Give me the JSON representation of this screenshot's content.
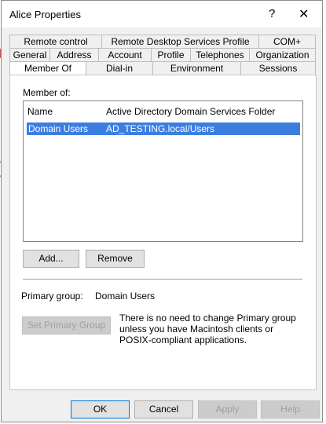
{
  "window": {
    "title": "Alice Properties",
    "help_glyph": "?",
    "close_glyph": "✕"
  },
  "tabs": {
    "row1": [
      "Remote control",
      "Remote Desktop Services Profile",
      "COM+"
    ],
    "row2": [
      "General",
      "Address",
      "Account",
      "Profile",
      "Telephones",
      "Organization"
    ],
    "row3": [
      "Member Of",
      "Dial-in",
      "Environment",
      "Sessions"
    ],
    "active": "Member Of"
  },
  "member_of": {
    "label": "Member of:",
    "columns": [
      "Name",
      "Active Directory Domain Services Folder"
    ],
    "rows": [
      {
        "name": "Domain Users",
        "folder": "AD_TESTING.local/Users",
        "selected": true
      }
    ],
    "add_label": "Add...",
    "remove_label": "Remove"
  },
  "primary_group": {
    "label": "Primary group:",
    "value": "Domain Users",
    "set_button_label": "Set Primary Group",
    "note": "There is no need to change Primary group unless you have Macintosh clients or POSIX-compliant applications."
  },
  "footer": {
    "ok": "OK",
    "cancel": "Cancel",
    "apply": "Apply",
    "help": "Help"
  },
  "colors": {
    "selection": "#3c7ee0",
    "dialog_bg": "#f0f0f0",
    "default_button_border": "#0078d7"
  },
  "icons": {
    "help": "question-mark-icon",
    "close": "close-icon"
  }
}
